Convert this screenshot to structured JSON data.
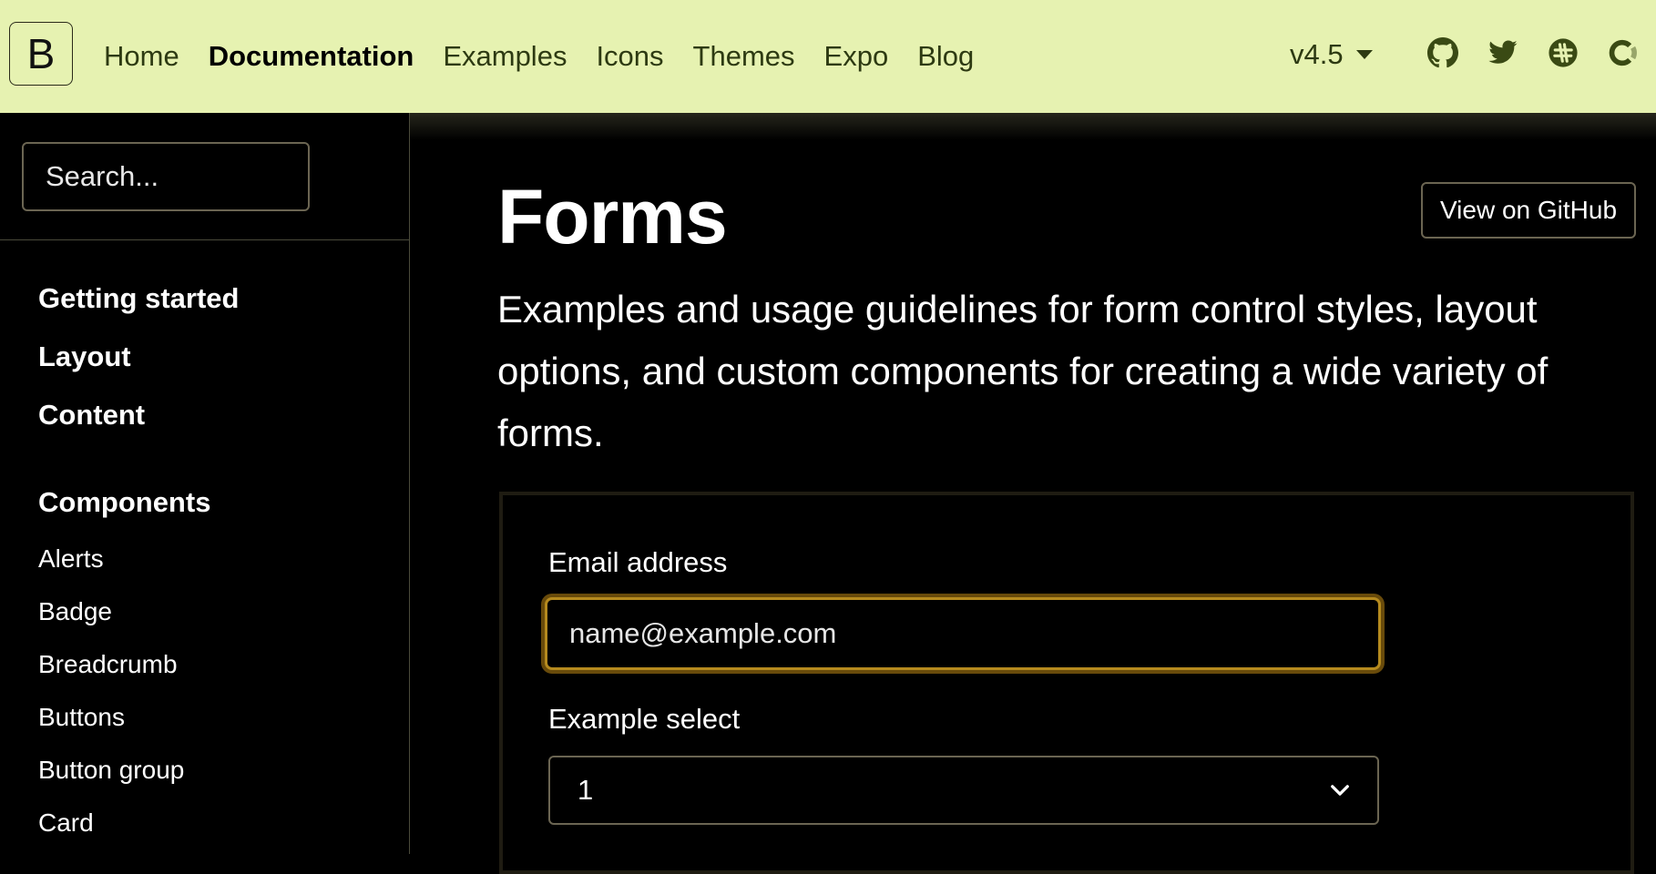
{
  "navbar": {
    "brand": "B",
    "links": [
      {
        "label": "Home",
        "active": false
      },
      {
        "label": "Documentation",
        "active": true
      },
      {
        "label": "Examples",
        "active": false
      },
      {
        "label": "Icons",
        "active": false
      },
      {
        "label": "Themes",
        "active": false
      },
      {
        "label": "Expo",
        "active": false
      },
      {
        "label": "Blog",
        "active": false
      }
    ],
    "version": "v4.5",
    "icons": [
      "github-icon",
      "twitter-icon",
      "slack-icon",
      "opencollective-icon"
    ],
    "background": "#e6f2b1"
  },
  "sidebar": {
    "search_placeholder": "Search...",
    "groups": [
      "Getting started",
      "Layout",
      "Content",
      "Components"
    ],
    "component_items": [
      "Alerts",
      "Badge",
      "Breadcrumb",
      "Buttons",
      "Button group",
      "Card"
    ]
  },
  "main": {
    "title": "Forms",
    "github_button": "View on GitHub",
    "lead": "Examples and usage guidelines for form control styles, layout options, and custom components for creating a wide variety of forms.",
    "form": {
      "email_label": "Email address",
      "email_placeholder": "name@example.com",
      "select_label": "Example select",
      "select_value": "1"
    },
    "focus_color": "#b58a1e"
  }
}
